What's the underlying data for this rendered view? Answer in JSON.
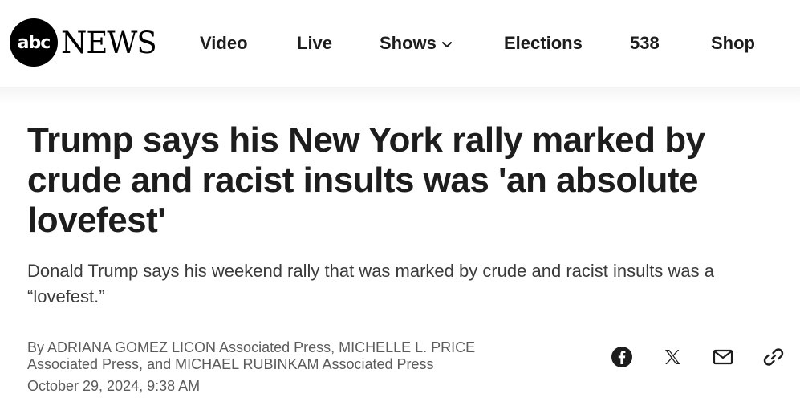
{
  "header": {
    "logo_badge": "abc",
    "logo_word": "NEWS",
    "nav": [
      {
        "label": "Video"
      },
      {
        "label": "Live"
      },
      {
        "label": "Shows"
      },
      {
        "label": "Elections"
      },
      {
        "label": "538"
      },
      {
        "label": "Shop"
      }
    ]
  },
  "article": {
    "headline": "Trump says his New York rally marked by crude and racist insults was 'an absolute lovefest'",
    "dek": "Donald Trump says his weekend rally that was marked by crude and racist insults was a “lovefest.”",
    "byline": "By ADRIANA GOMEZ LICON Associated Press, MICHELLE L. PRICE Associated Press, and MICHAEL RUBINKAM Associated Press",
    "date": "October 29, 2024, 9:38 AM"
  },
  "share": {
    "icons": [
      "facebook-icon",
      "x-icon",
      "email-icon",
      "link-icon"
    ]
  },
  "colors": {
    "text": "#1d1d1d",
    "secondary_text": "#5c5c5c",
    "logo_bg": "#000000"
  }
}
